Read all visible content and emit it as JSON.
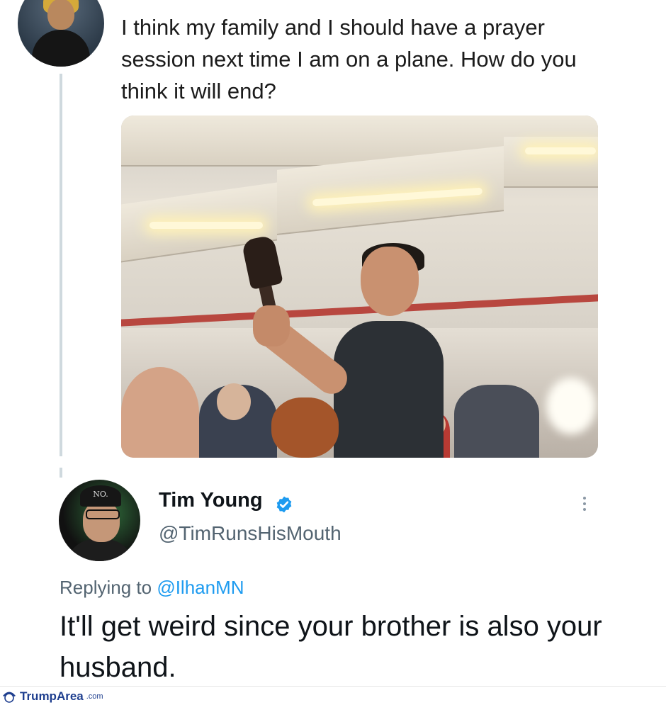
{
  "original_tweet": {
    "text": "I think my family and I should have a prayer session next time I am on a plane. How do you think it will end?"
  },
  "reply_tweet": {
    "author_name": "Tim Young",
    "handle": "@TimRunsHisMouth",
    "replying_prefix": "Replying to ",
    "replying_to": "@IlhanMN",
    "text": "It'll get weird since your brother is also your husband."
  },
  "watermark": {
    "brand": "TrumpArea",
    "suffix": ".com"
  },
  "colors": {
    "verified_badge": "#1d9bf0",
    "handle": "#536471",
    "link": "#1d9bf0"
  },
  "icons": [
    "verified-badge-icon",
    "more-options-icon",
    "watermark-logo-icon"
  ]
}
